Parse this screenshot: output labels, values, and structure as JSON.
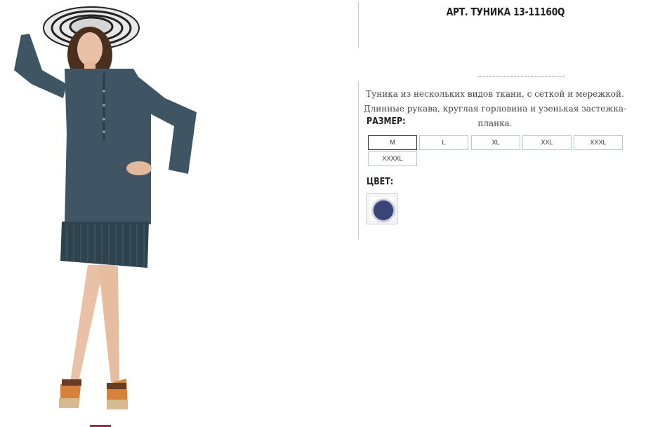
{
  "product": {
    "title": "АРТ. ТУНИКА 13-11160Q",
    "description": "Туника из нескольких видов ткани, с сеткой и мережкой. Длинные рукава, круглая горловина и узенькая застежка-планка."
  },
  "sizes": {
    "label": "РАЗМЕР:",
    "options": [
      "M",
      "L",
      "XL",
      "XXL",
      "XXXL",
      "XXXXL"
    ],
    "selected": "M"
  },
  "colors": {
    "label": "ЦВЕТ:",
    "swatches": [
      {
        "hex": "#3a4575"
      }
    ]
  },
  "theme": {
    "dress_color": "#3f5563",
    "indicator_color": "#a02a4a"
  }
}
